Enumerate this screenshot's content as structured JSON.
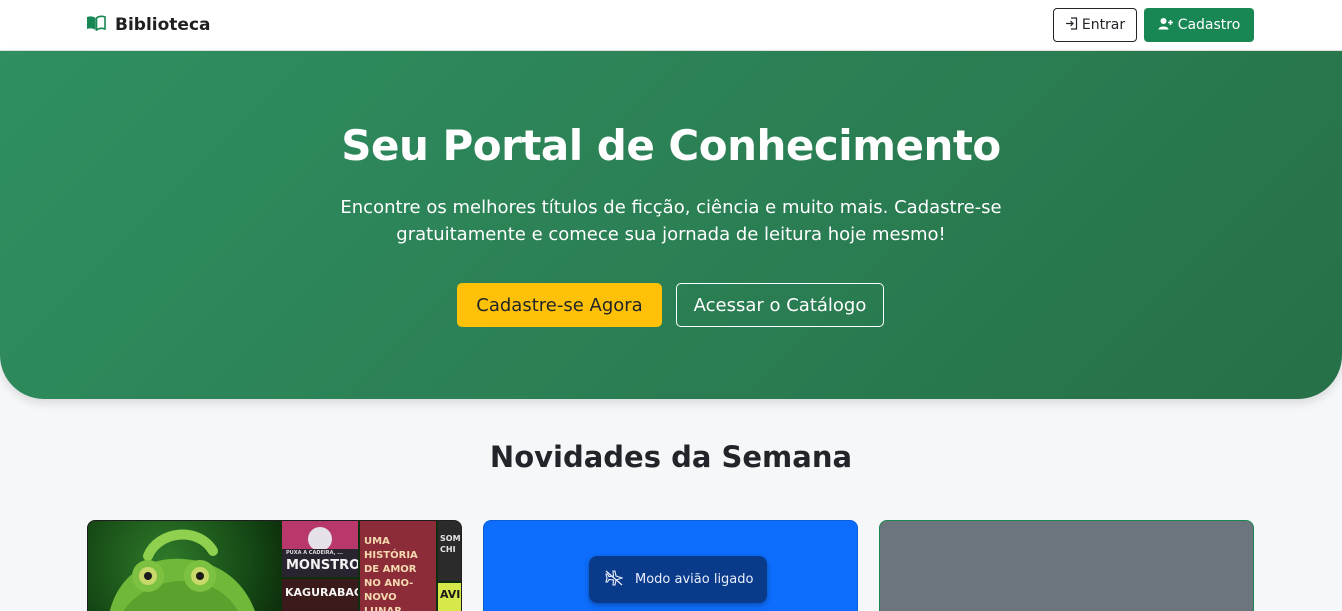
{
  "navbar": {
    "brand": "Biblioteca",
    "login_label": "Entrar",
    "signup_label": "Cadastro"
  },
  "hero": {
    "title": "Seu Portal de Conhecimento",
    "subtitle_line1": "Encontre os melhores títulos de ficção, ciência e muito mais. Cadastre-se",
    "subtitle_line2": "gratuitamente e comece sua jornada de leitura hoje mesmo!",
    "primary_button": "Cadastre-se Agora",
    "secondary_button": "Acessar o Catálogo"
  },
  "news": {
    "title": "Novidades da Semana",
    "cards": [
      {
        "covers": [
          {
            "text_small": "PUXA A CADEIRA, ...",
            "text_big": "MONSTRO"
          },
          {
            "text_big": "UMA HISTÓRIA DE AMOR NO ANO-NOVO LUNAR"
          },
          {
            "text_big": "SOMKIL CHI"
          },
          {
            "text_big": "KAGURABACHI"
          },
          {
            "text_big": "AVI"
          }
        ]
      },
      {
        "toast": "Modo avião ligado"
      },
      {}
    ]
  },
  "colors": {
    "primary_green": "#198754",
    "hero_green": "#2f8f60",
    "accent_yellow": "#ffc107",
    "card_blue": "#0d6efd",
    "card_gray": "#6c757d"
  },
  "icons": {
    "brand": "book-open-icon",
    "login": "sign-in-icon",
    "signup": "user-plus-icon",
    "toast": "airplane-off-icon"
  }
}
